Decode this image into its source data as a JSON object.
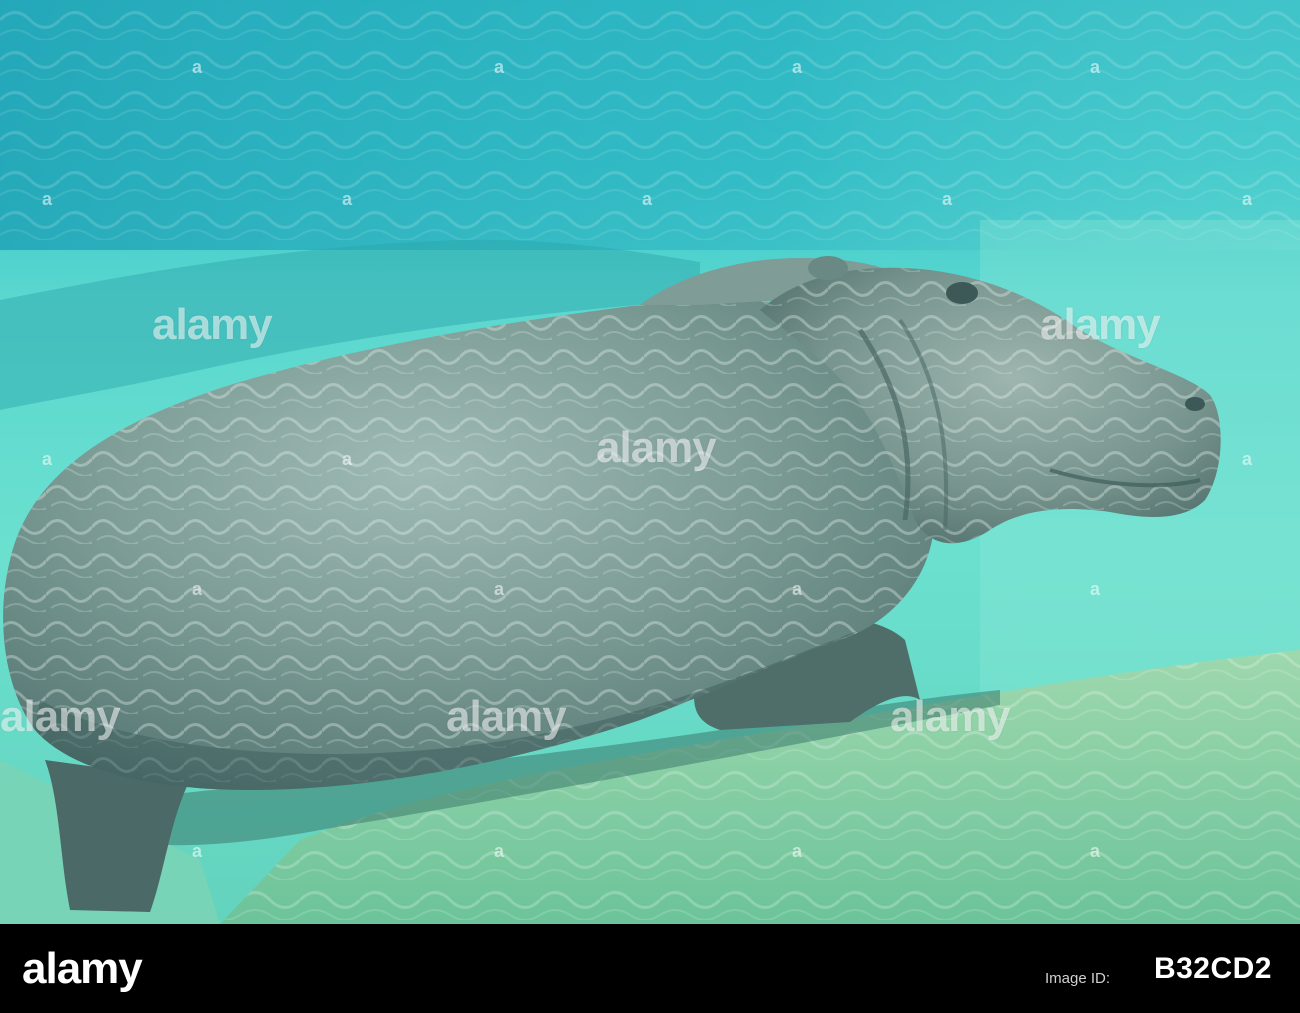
{
  "photo": {
    "subject": "hippopotamus-underwater",
    "colors": {
      "water_light": "#7fe3d6",
      "water_deep": "#1fb2b4",
      "surface": "#4fc9d2",
      "hippo_body": "#6e8f8a",
      "hippo_shadow": "#3f615f",
      "rock": "#8ccfa6",
      "rock_light": "#b8e4b5"
    }
  },
  "watermark": {
    "text": "alamy",
    "marker": "a"
  },
  "footer": {
    "logo": "alamy",
    "id_label": "Image ID:",
    "image_id": "B32CD2",
    "background": "#000000"
  }
}
